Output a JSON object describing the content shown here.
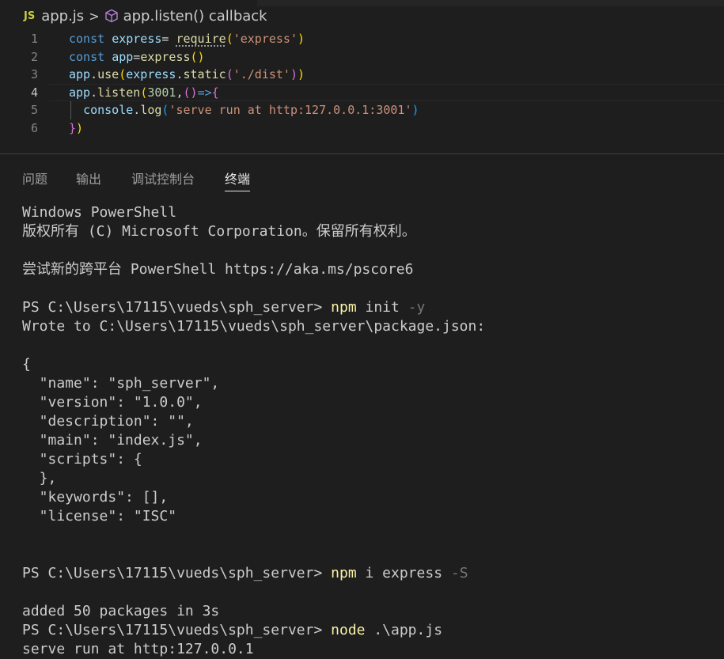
{
  "breadcrumb": {
    "lang_badge": "JS",
    "file": "app.js",
    "separator": ">",
    "symbol": "app.listen() callback"
  },
  "editor": {
    "line_numbers": [
      "1",
      "2",
      "3",
      "4",
      "5",
      "6"
    ],
    "lines": [
      [
        {
          "t": "const ",
          "c": "kw"
        },
        {
          "t": "express",
          "c": "var"
        },
        {
          "t": "= ",
          "c": "plain"
        },
        {
          "t": "require",
          "c": "fn squig"
        },
        {
          "t": "(",
          "c": "br1"
        },
        {
          "t": "'express'",
          "c": "str"
        },
        {
          "t": ")",
          "c": "br1"
        }
      ],
      [
        {
          "t": "const ",
          "c": "kw"
        },
        {
          "t": "app",
          "c": "var"
        },
        {
          "t": "=",
          "c": "plain"
        },
        {
          "t": "express",
          "c": "fn"
        },
        {
          "t": "()",
          "c": "br1"
        }
      ],
      [
        {
          "t": "app",
          "c": "var"
        },
        {
          "t": ".",
          "c": "plain"
        },
        {
          "t": "use",
          "c": "fn"
        },
        {
          "t": "(",
          "c": "br1"
        },
        {
          "t": "express",
          "c": "var"
        },
        {
          "t": ".",
          "c": "plain"
        },
        {
          "t": "static",
          "c": "fn"
        },
        {
          "t": "(",
          "c": "br2"
        },
        {
          "t": "'./dist'",
          "c": "str"
        },
        {
          "t": ")",
          "c": "br2"
        },
        {
          "t": ")",
          "c": "br1"
        }
      ],
      [
        {
          "t": "app",
          "c": "var"
        },
        {
          "t": ".",
          "c": "plain"
        },
        {
          "t": "listen",
          "c": "fn"
        },
        {
          "t": "(",
          "c": "br1"
        },
        {
          "t": "3001",
          "c": "num"
        },
        {
          "t": ",",
          "c": "plain"
        },
        {
          "t": "()",
          "c": "br2"
        },
        {
          "t": "=>",
          "c": "kw"
        },
        {
          "t": "{",
          "c": "br2"
        }
      ],
      [
        {
          "t": "  ",
          "c": "plain"
        },
        {
          "t": "console",
          "c": "var"
        },
        {
          "t": ".",
          "c": "plain"
        },
        {
          "t": "log",
          "c": "fn"
        },
        {
          "t": "(",
          "c": "br3"
        },
        {
          "t": "'serve run at http:127.0.0.1:3001'",
          "c": "str"
        },
        {
          "t": ")",
          "c": "br3"
        }
      ],
      [
        {
          "t": "}",
          "c": "br2"
        },
        {
          "t": ")",
          "c": "br1"
        }
      ]
    ],
    "current_line": 4
  },
  "panel_tabs": [
    {
      "label": "问题",
      "active": false
    },
    {
      "label": "输出",
      "active": false
    },
    {
      "label": "调试控制台",
      "active": false
    },
    {
      "label": "终端",
      "active": true
    }
  ],
  "terminal": {
    "lines": [
      [
        {
          "t": "Windows PowerShell",
          "c": ""
        }
      ],
      [
        {
          "t": "版权所有 (C) Microsoft Corporation。保留所有权利。",
          "c": ""
        }
      ],
      [
        {
          "t": "",
          "c": ""
        }
      ],
      [
        {
          "t": "尝试新的跨平台 PowerShell https://aka.ms/pscore6",
          "c": ""
        }
      ],
      [
        {
          "t": "",
          "c": ""
        }
      ],
      [
        {
          "t": "PS C:\\Users\\17115\\vueds\\sph_server> ",
          "c": ""
        },
        {
          "t": "npm",
          "c": "cmd-y"
        },
        {
          "t": " init ",
          "c": ""
        },
        {
          "t": "-y",
          "c": "cmd-dim"
        }
      ],
      [
        {
          "t": "Wrote to C:\\Users\\17115\\vueds\\sph_server\\package.json:",
          "c": ""
        }
      ],
      [
        {
          "t": "",
          "c": ""
        }
      ],
      [
        {
          "t": "{",
          "c": ""
        }
      ],
      [
        {
          "t": "  \"name\": \"sph_server\",",
          "c": ""
        }
      ],
      [
        {
          "t": "  \"version\": \"1.0.0\",",
          "c": ""
        }
      ],
      [
        {
          "t": "  \"description\": \"\",",
          "c": ""
        }
      ],
      [
        {
          "t": "  \"main\": \"index.js\",",
          "c": ""
        }
      ],
      [
        {
          "t": "  \"scripts\": {",
          "c": ""
        }
      ],
      [
        {
          "t": "  },",
          "c": ""
        }
      ],
      [
        {
          "t": "  \"keywords\": [],",
          "c": ""
        }
      ],
      [
        {
          "t": "  \"license\": \"ISC\"",
          "c": ""
        }
      ],
      [
        {
          "t": "",
          "c": ""
        }
      ],
      [
        {
          "t": "",
          "c": ""
        }
      ],
      [
        {
          "t": "PS C:\\Users\\17115\\vueds\\sph_server> ",
          "c": ""
        },
        {
          "t": "npm",
          "c": "cmd-y"
        },
        {
          "t": " i express ",
          "c": ""
        },
        {
          "t": "-S",
          "c": "cmd-dim"
        }
      ],
      [
        {
          "t": "",
          "c": ""
        }
      ],
      [
        {
          "t": "added 50 packages in 3s",
          "c": ""
        }
      ],
      [
        {
          "t": "PS C:\\Users\\17115\\vueds\\sph_server> ",
          "c": ""
        },
        {
          "t": "node",
          "c": "cmd-y"
        },
        {
          "t": " .\\app.js",
          "c": ""
        }
      ],
      [
        {
          "t": "serve run at http:127.0.0.1",
          "c": ""
        }
      ]
    ]
  },
  "colors": {
    "background": "#1e1e1e",
    "keyword": "#569cd6",
    "function": "#dcdcaa",
    "string": "#ce9178",
    "command": "#f9f1a5"
  }
}
